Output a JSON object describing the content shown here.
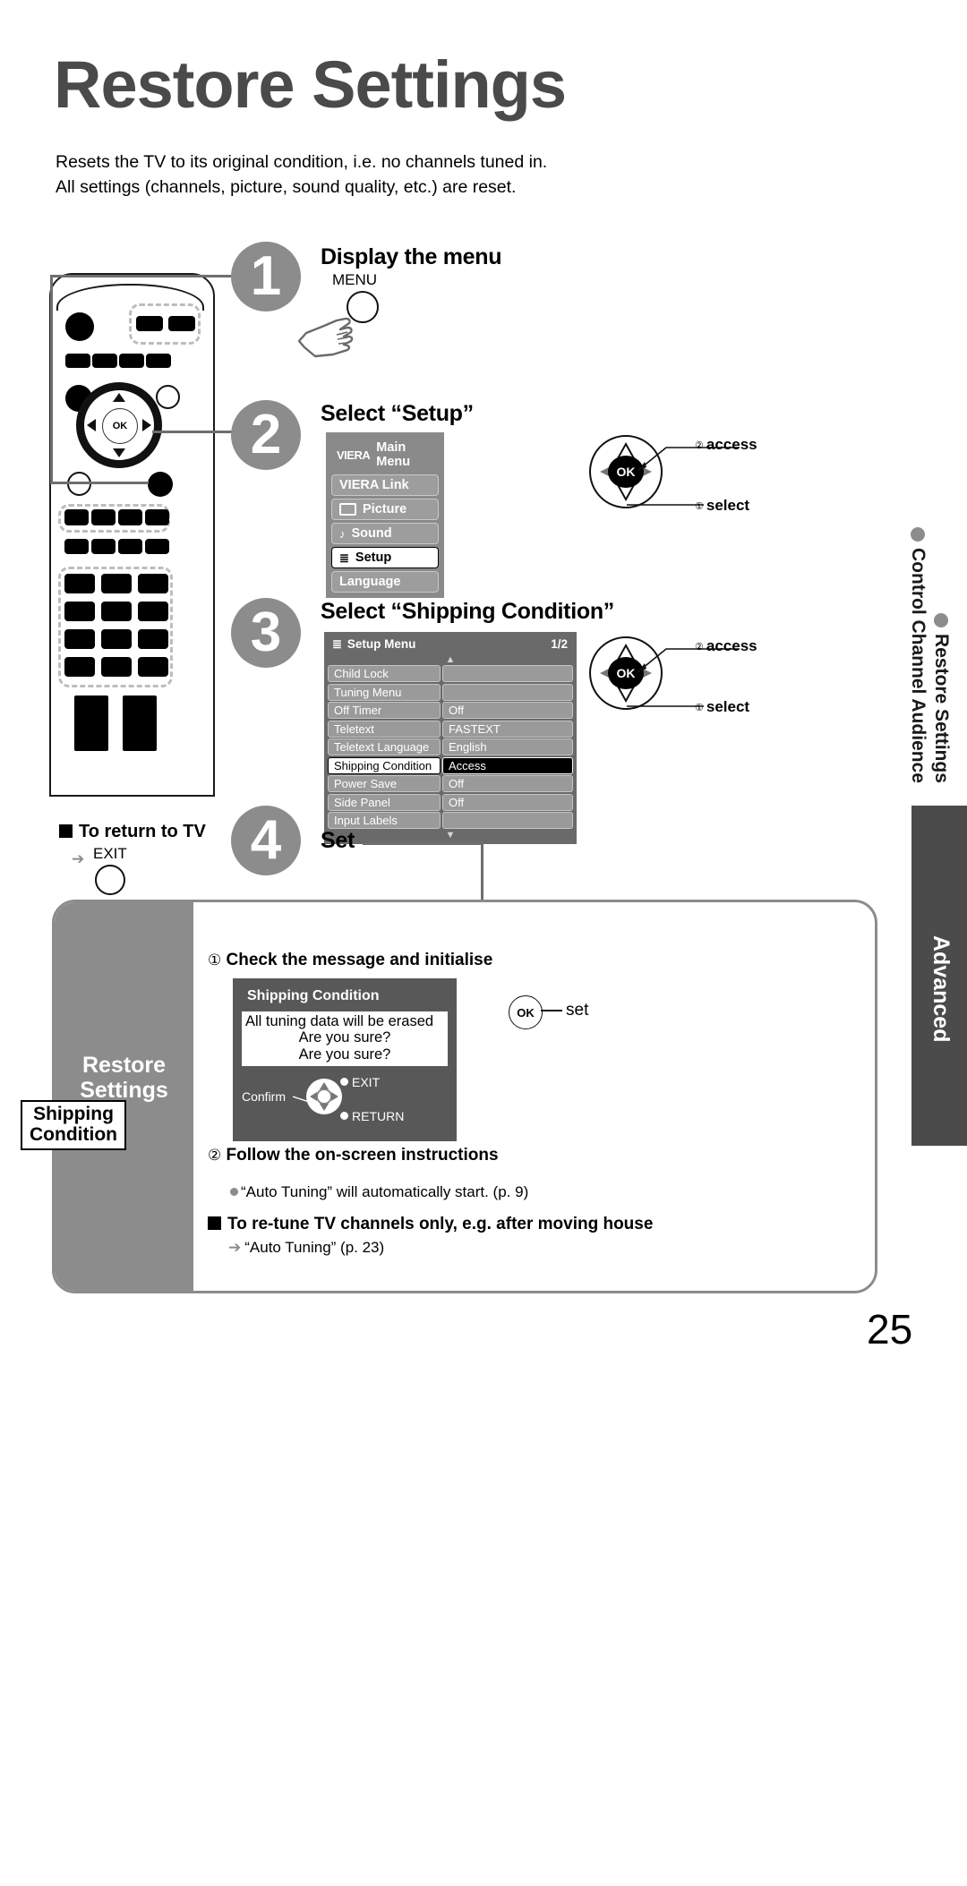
{
  "page": {
    "title": "Restore Settings",
    "intro_line1": "Resets the TV to its original condition, i.e. no channels tuned in.",
    "intro_line2": "All settings (channels, picture, sound quality, etc.) are reset.",
    "number": "25"
  },
  "steps": {
    "one": {
      "num": "1",
      "heading": "Display the menu",
      "button_label": "MENU"
    },
    "two": {
      "num": "2",
      "heading": "Select “Setup”"
    },
    "three": {
      "num": "3",
      "heading": "Select “Shipping Condition”"
    },
    "four": {
      "num": "4",
      "heading": "Set"
    }
  },
  "return_to_tv": {
    "heading": "To return to TV",
    "button_label": "EXIT"
  },
  "main_menu": {
    "brand": "VIERA",
    "title": "Main Menu",
    "items": [
      {
        "label": "VIERA Link",
        "icon": "",
        "selected": false
      },
      {
        "label": "Picture",
        "icon": "picture-icon",
        "selected": false
      },
      {
        "label": "Sound",
        "icon": "music-note-icon",
        "selected": false
      },
      {
        "label": "Setup",
        "icon": "list-icon",
        "selected": true
      },
      {
        "label": "Language",
        "icon": "",
        "selected": false
      }
    ]
  },
  "setup_menu": {
    "title": "Setup Menu",
    "page_indicator": "1/2",
    "rows": [
      {
        "label": "Child Lock",
        "value": "",
        "highlight": false
      },
      {
        "label": "Tuning Menu",
        "value": "",
        "highlight": false
      },
      {
        "label": "Off Timer",
        "value": "Off",
        "highlight": false
      },
      {
        "label": "Teletext",
        "value": "FASTEXT",
        "highlight": false
      },
      {
        "label": "Teletext Language",
        "value": "English",
        "highlight": false
      },
      {
        "label": "Shipping Condition",
        "value": "Access",
        "highlight": true
      },
      {
        "label": "Power Save",
        "value": "Off",
        "highlight": false
      },
      {
        "label": "Side Panel",
        "value": "Off",
        "highlight": false
      },
      {
        "label": "Input Labels",
        "value": "",
        "highlight": false
      }
    ]
  },
  "nav_wheel": {
    "ok_label": "OK",
    "access_num": "②",
    "access_label": "access",
    "select_num": "①",
    "select_label": "select"
  },
  "bottom_panel": {
    "side_title_line1": "Restore",
    "side_title_line2": "Settings",
    "chip_line1": "Shipping",
    "chip_line2": "Condition",
    "sub1_num": "①",
    "sub1_text": "Check the message and initialise",
    "sub2_num": "②",
    "sub2_text": "Follow the on-screen instructions",
    "bullet_text": "“Auto Tuning” will automatically start. (p. 9)",
    "retune_heading": "To re-tune TV channels only, e.g. after moving house",
    "retune_ref": "“Auto Tuning” (p. 23)",
    "ok_set_label": "set",
    "ok_glyph": "OK"
  },
  "shipping_dialog": {
    "title": "Shipping Condition",
    "message_line1": "All tuning data will be erased",
    "message_line2": "Are you sure?",
    "message_line3": "Are you sure?",
    "confirm_label": "Confirm",
    "exit_label": "EXIT",
    "return_label": "RETURN"
  },
  "rail": {
    "chapter_line1": "Control Channel Audience",
    "chapter_line2": "Restore Settings",
    "tab_label": "Advanced"
  },
  "colors": {
    "title_grey": "#4a4a4a",
    "step_grey": "#8c8c8c",
    "osd_grey": "#8a8a8a",
    "setup_grey": "#6a6a6a",
    "dialog_grey": "#585858",
    "tab_grey": "#4b4b4b"
  }
}
